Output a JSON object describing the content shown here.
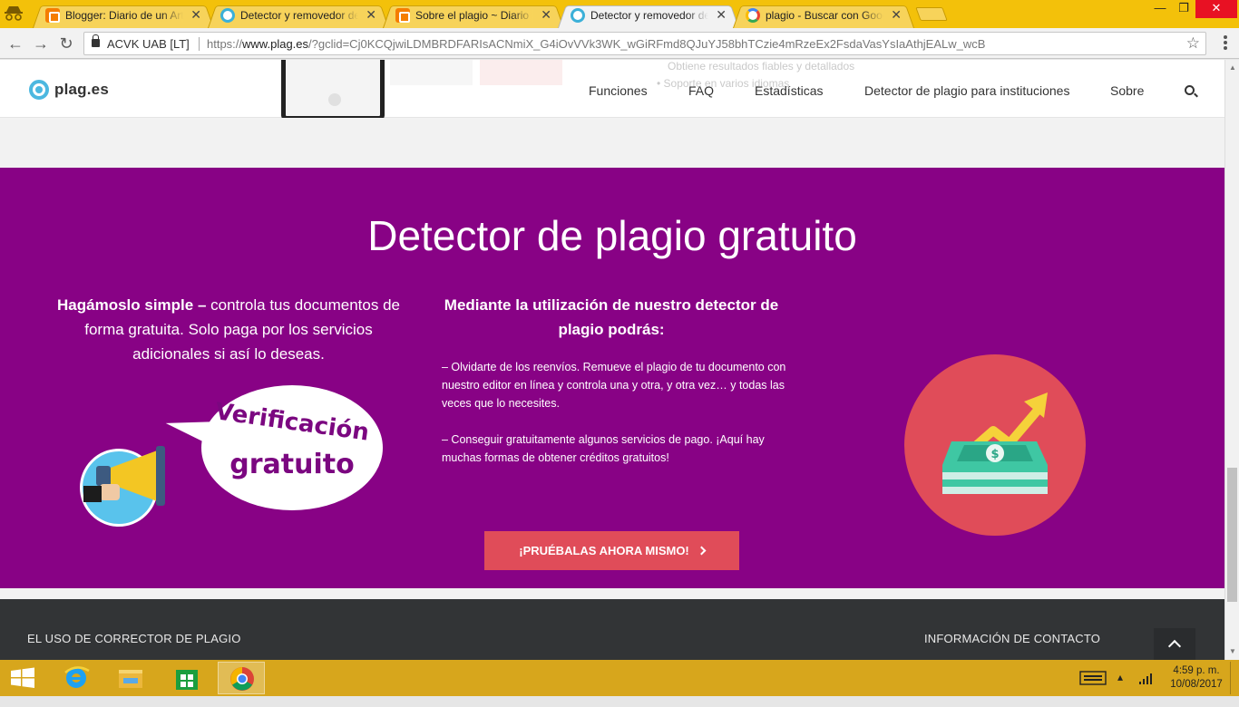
{
  "browser": {
    "tabs": [
      {
        "title": "Blogger: Diario de un Art",
        "favicon": "blogger-icon",
        "active": false
      },
      {
        "title": "Detector y removedor de",
        "favicon": "plag-icon",
        "active": false
      },
      {
        "title": "Sobre el plagio ~ Diario",
        "favicon": "blogger-icon",
        "active": false
      },
      {
        "title": "Detector y removedor de",
        "favicon": "plag-icon",
        "active": true
      },
      {
        "title": "plagio - Buscar con Goog",
        "favicon": "google-icon",
        "active": false
      }
    ],
    "certificate": "ACVK UAB [LT]",
    "url_prefix": "https://",
    "url_host": "www.plag.es",
    "url_rest": "/?gclid=Cj0KCQjwiLDMBRDFARIsACNmiX_G4iOvVVk3WK_wGiRFmd8QJuYJ58bhTCzie4mRzeEx2FsdaVasYsIaAthjEALw_wcB"
  },
  "header": {
    "logo_text": "plag.es",
    "ghost_text_1": "Obtiene resultados fiables y detallados",
    "ghost_text_2": "• Soporte en varios idiomas",
    "nav": [
      "Funciones",
      "FAQ",
      "Estadísticas",
      "Detector de plagio para instituciones",
      "Sobre"
    ]
  },
  "hero": {
    "title": "Detector de plagio gratuito",
    "left_bold": "Hagámoslo simple –",
    "left_text": " controla tus documentos de forma gratuita. Solo paga por los servicios adicionales si así lo deseas.",
    "promo_line1": "Verificación",
    "promo_line2": "gratuito",
    "mid_heading": "Mediante la utilización de nuestro detector de plagio podrás:",
    "mid_items": [
      "– Olvidarte de los reenvíos. Remueve el plagio de tu documento con nuestro editor en línea y controla una y otra, y otra vez… y todas las veces que lo necesites.",
      "– Conseguir gratuitamente algunos servicios de pago. ¡Aquí hay muchas formas de obtener créditos gratuitos!"
    ],
    "cta": "¡PRUÉBALAS AHORA MISMO!"
  },
  "footer": {
    "left_heading": "EL USO DE CORRECTOR DE PLAGIO",
    "right_heading": "INFORMACIÓN DE CONTACTO"
  },
  "taskbar": {
    "time": "4:59 p. m.",
    "date": "10/08/2017"
  },
  "colors": {
    "hero_bg": "#880285",
    "cta_bg": "#e04c59",
    "footer_bg": "#323436",
    "chrome_incognito_frame": "#f3c10a"
  }
}
